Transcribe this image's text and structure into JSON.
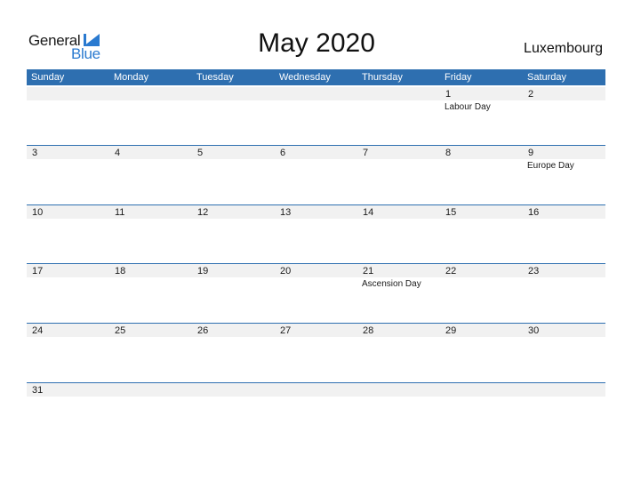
{
  "brand": {
    "line1": "General",
    "line2": "Blue",
    "accent": "#2a7ad0"
  },
  "title": "May 2020",
  "country": "Luxembourg",
  "header_color": "#2e6fb0",
  "weekdays": [
    "Sunday",
    "Monday",
    "Tuesday",
    "Wednesday",
    "Thursday",
    "Friday",
    "Saturday"
  ],
  "weeks": [
    [
      {
        "day": ""
      },
      {
        "day": ""
      },
      {
        "day": ""
      },
      {
        "day": ""
      },
      {
        "day": ""
      },
      {
        "day": "1",
        "event": "Labour Day"
      },
      {
        "day": "2"
      }
    ],
    [
      {
        "day": "3"
      },
      {
        "day": "4"
      },
      {
        "day": "5"
      },
      {
        "day": "6"
      },
      {
        "day": "7"
      },
      {
        "day": "8"
      },
      {
        "day": "9",
        "event": "Europe Day"
      }
    ],
    [
      {
        "day": "10"
      },
      {
        "day": "11"
      },
      {
        "day": "12"
      },
      {
        "day": "13"
      },
      {
        "day": "14"
      },
      {
        "day": "15"
      },
      {
        "day": "16"
      }
    ],
    [
      {
        "day": "17"
      },
      {
        "day": "18"
      },
      {
        "day": "19"
      },
      {
        "day": "20"
      },
      {
        "day": "21",
        "event": "Ascension Day"
      },
      {
        "day": "22"
      },
      {
        "day": "23"
      }
    ],
    [
      {
        "day": "24"
      },
      {
        "day": "25"
      },
      {
        "day": "26"
      },
      {
        "day": "27"
      },
      {
        "day": "28"
      },
      {
        "day": "29"
      },
      {
        "day": "30"
      }
    ],
    [
      {
        "day": "31"
      },
      {
        "day": ""
      },
      {
        "day": ""
      },
      {
        "day": ""
      },
      {
        "day": ""
      },
      {
        "day": ""
      },
      {
        "day": ""
      }
    ]
  ]
}
